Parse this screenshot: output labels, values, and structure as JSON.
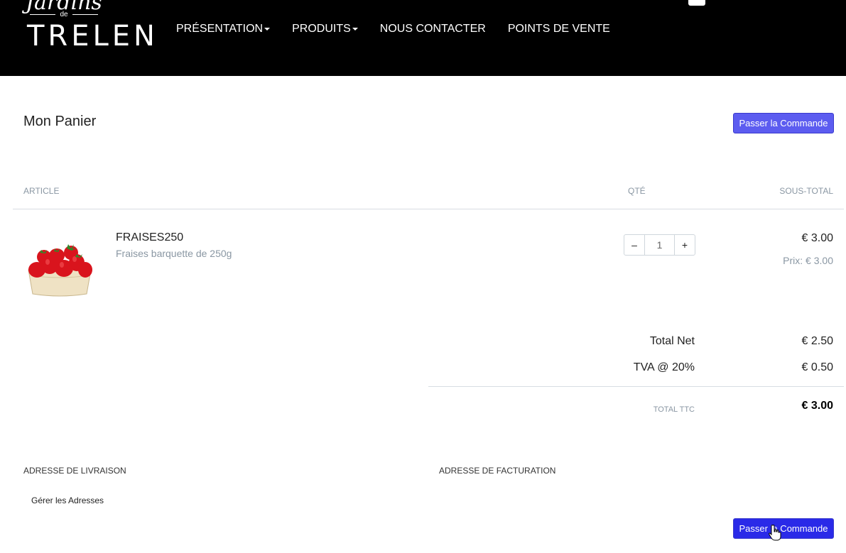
{
  "header": {
    "logo_script": "Jardins",
    "logo_de": "de",
    "logo_brand": "TRELEN",
    "nav": [
      "PRÉSENTATION",
      "PRODUITS",
      "NOUS CONTACTER",
      "POINTS DE VENTE"
    ]
  },
  "cart": {
    "title": "Mon Panier",
    "checkout_label": "Passer la Commande",
    "columns": {
      "article": "ARTICLE",
      "qty": "QTÉ",
      "subtotal": "SOUS-TOTAL"
    },
    "item": {
      "name": "FRAISES250",
      "description": "Fraises barquette de 250g",
      "quantity": "1",
      "decrement": "–",
      "increment": "+",
      "subtotal": "€ 3.00",
      "unit_price": "Prix: € 3.00"
    },
    "summary": {
      "net_label": "Total Net",
      "net_value": "€ 2.50",
      "tax_label": "TVA @ 20%",
      "tax_value": "€ 0.50",
      "total_label": "TOTAL TTC",
      "total_value": "€ 3.00"
    },
    "addresses": {
      "delivery_label": "ADRESSE DE LIVRAISON",
      "billing_label": "ADRESSE DE FACTURATION",
      "manage_link": "Gérer les Adresses"
    }
  },
  "colors": {
    "header_bg": "#000000",
    "primary_button": "#5c5cf0",
    "muted_text": "#8a97a3"
  }
}
